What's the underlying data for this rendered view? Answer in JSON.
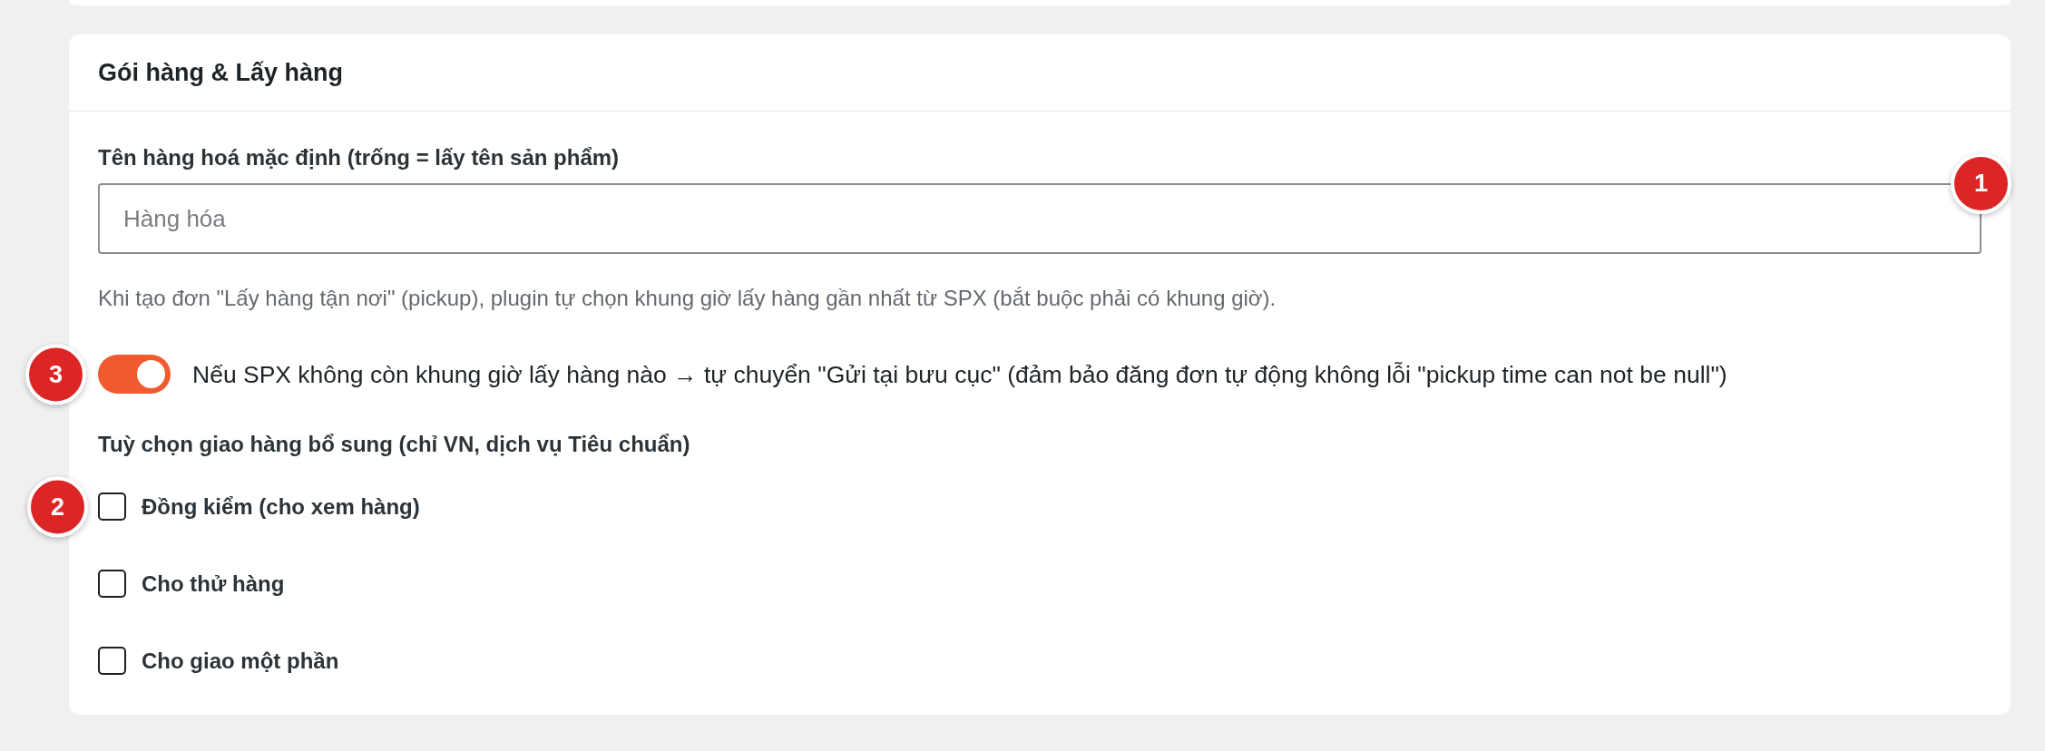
{
  "section": {
    "title": "Gói hàng & Lấy hàng"
  },
  "goods_name": {
    "label": "Tên hàng hoá mặc định (trống = lấy tên sản phẩm)",
    "placeholder": "Hàng hóa",
    "marker": "1"
  },
  "pickup_hint": "Khi tạo đơn \"Lấy hàng tận nơi\" (pickup), plugin tự chọn khung giờ lấy hàng gần nhất từ SPX (bắt buộc phải có khung giờ).",
  "fallback_toggle": {
    "label": "Nếu SPX không còn khung giờ lấy hàng nào → tự chuyển \"Gửi tại bưu cục\" (đảm bảo đăng đơn tự động không lỗi \"pickup time can not be null\")",
    "on": true,
    "marker": "3"
  },
  "extra_options": {
    "title": "Tuỳ chọn giao hàng bổ sung (chỉ VN, dịch vụ Tiêu chuẩn)",
    "options": [
      {
        "label": "Đồng kiểm (cho xem hàng)",
        "checked": false,
        "marker": "2"
      },
      {
        "label": "Cho thử hàng",
        "checked": false
      },
      {
        "label": "Cho giao một phần",
        "checked": false
      }
    ]
  }
}
